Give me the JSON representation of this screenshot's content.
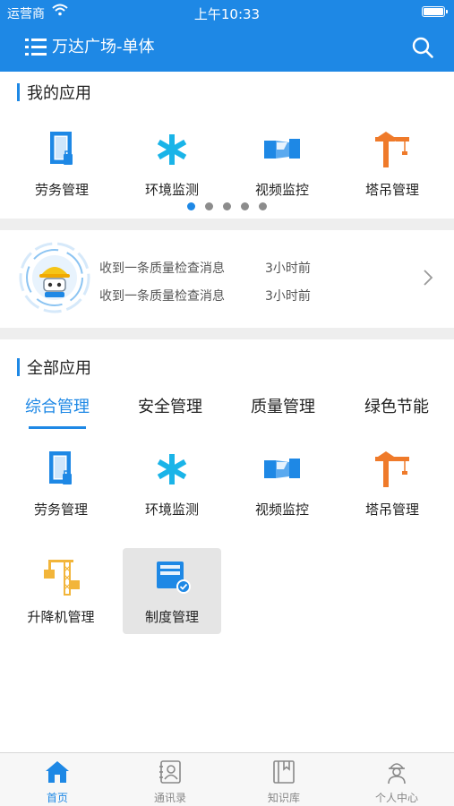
{
  "status_bar": {
    "carrier": "运营商",
    "time": "上午10:33"
  },
  "nav": {
    "title": "万达广场-单体"
  },
  "my_apps": {
    "title": "我的应用",
    "items": [
      {
        "label": "劳务管理",
        "icon": "labor-door-icon"
      },
      {
        "label": "环境监测",
        "icon": "asterisk-icon"
      },
      {
        "label": "视频监控",
        "icon": "camera-icon"
      },
      {
        "label": "塔吊管理",
        "icon": "tower-crane-icon"
      }
    ],
    "page_count": 5,
    "current_page": 1
  },
  "notice": {
    "messages": [
      {
        "text": "收到一条质量检查消息",
        "time": "3小时前"
      },
      {
        "text": "收到一条质量检查消息",
        "time": "3小时前"
      }
    ]
  },
  "all_apps": {
    "title": "全部应用",
    "tabs": [
      "综合管理",
      "安全管理",
      "质量管理",
      "绿色节能"
    ],
    "active_tab": 0,
    "items": [
      {
        "label": "劳务管理",
        "icon": "labor-door-icon"
      },
      {
        "label": "环境监测",
        "icon": "asterisk-icon"
      },
      {
        "label": "视频监控",
        "icon": "camera-icon"
      },
      {
        "label": "塔吊管理",
        "icon": "tower-crane-icon"
      },
      {
        "label": "升降机管理",
        "icon": "elevator-icon"
      },
      {
        "label": "制度管理",
        "icon": "policy-icon"
      }
    ],
    "selected_item": 5
  },
  "tabbar": {
    "items": [
      {
        "label": "首页",
        "icon": "home-icon"
      },
      {
        "label": "通讯录",
        "icon": "contacts-icon"
      },
      {
        "label": "知识库",
        "icon": "book-icon"
      },
      {
        "label": "个人中心",
        "icon": "worker-avatar-icon"
      }
    ],
    "active": 0
  },
  "colors": {
    "primary": "#1e88e5",
    "cyan": "#1ab4e8",
    "orange": "#ef7a2a",
    "yellow": "#f2b53a",
    "divider": "#eeeeee"
  }
}
